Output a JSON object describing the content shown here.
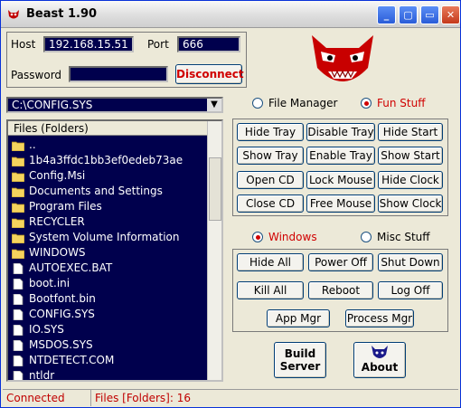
{
  "window": {
    "title": "Beast 1.90"
  },
  "connection": {
    "host_label": "Host",
    "host_value": "192.168.15.51",
    "port_label": "Port",
    "port_value": "666",
    "password_label": "Password",
    "password_value": "",
    "disconnect_label": "Disconnect"
  },
  "path_combo": {
    "value": "C:\\CONFIG.SYS"
  },
  "file_list": {
    "header": "Files (Folders)",
    "items": [
      {
        "name": "..",
        "type": "folder"
      },
      {
        "name": "1b4a3ffdc1bb3ef0edeb73ae",
        "type": "folder"
      },
      {
        "name": "Config.Msi",
        "type": "folder"
      },
      {
        "name": "Documents and Settings",
        "type": "folder"
      },
      {
        "name": "Program Files",
        "type": "folder"
      },
      {
        "name": "RECYCLER",
        "type": "folder"
      },
      {
        "name": "System Volume Information",
        "type": "folder"
      },
      {
        "name": "WINDOWS",
        "type": "folder"
      },
      {
        "name": "AUTOEXEC.BAT",
        "type": "file"
      },
      {
        "name": "boot.ini",
        "type": "file"
      },
      {
        "name": "Bootfont.bin",
        "type": "file"
      },
      {
        "name": "CONFIG.SYS",
        "type": "file"
      },
      {
        "name": "IO.SYS",
        "type": "file"
      },
      {
        "name": "MSDOS.SYS",
        "type": "file"
      },
      {
        "name": "NTDETECT.COM",
        "type": "file"
      },
      {
        "name": "ntldr",
        "type": "file"
      }
    ]
  },
  "mode_radios": {
    "file_manager": "File Manager",
    "fun_stuff": "Fun Stuff",
    "selected": "fun_stuff"
  },
  "fun_buttons": {
    "hide_tray": "Hide Tray",
    "disable_tray": "Disable Tray",
    "hide_start": "Hide Start",
    "show_tray": "Show Tray",
    "enable_tray": "Enable Tray",
    "show_start": "Show Start",
    "open_cd": "Open CD",
    "lock_mouse": "Lock Mouse",
    "hide_clock": "Hide Clock",
    "close_cd": "Close CD",
    "free_mouse": "Free Mouse",
    "show_clock": "Show Clock"
  },
  "os_radios": {
    "windows": "Windows",
    "misc_stuff": "Misc Stuff",
    "selected": "windows"
  },
  "windows_buttons": {
    "hide_all": "Hide All",
    "power_off": "Power Off",
    "shut_down": "Shut Down",
    "kill_all": "Kill All",
    "reboot": "Reboot",
    "log_off": "Log Off",
    "app_mgr": "App Mgr",
    "process_mgr": "Process Mgr"
  },
  "bottom_buttons": {
    "build_server_line1": "Build",
    "build_server_line2": "Server",
    "about": "About"
  },
  "status": {
    "connection": "Connected",
    "files": "Files [Folders]: 16"
  },
  "colors": {
    "accent_red": "#d00000",
    "field_bg": "#00004d",
    "window_bg": "#ece9d8"
  }
}
